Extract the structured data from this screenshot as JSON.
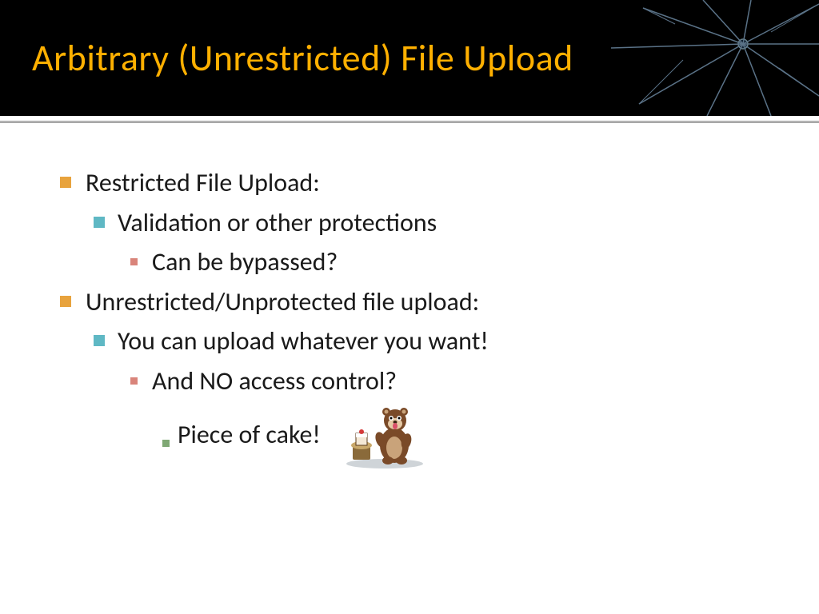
{
  "title": "Arbitrary (Unrestricted) File Upload",
  "sections": [
    {
      "text": "Restricted File Upload:",
      "children": [
        {
          "text": "Validation or other protections",
          "children": [
            {
              "text": "Can be bypassed?"
            }
          ]
        }
      ]
    },
    {
      "text": "Unrestricted/Unprotected file upload:",
      "children": [
        {
          "text": "You can upload whatever you want!",
          "children": [
            {
              "text": "And NO access control?",
              "children": [
                {
                  "text": "Piece of cake!"
                }
              ]
            }
          ]
        }
      ]
    }
  ]
}
